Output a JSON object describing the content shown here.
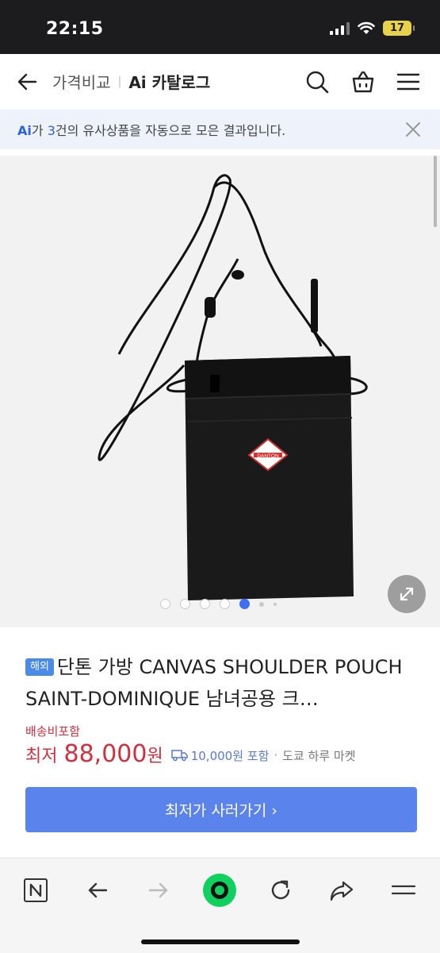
{
  "status_bar": {
    "time": "22:15",
    "battery": "17"
  },
  "header": {
    "breadcrumb_1": "가격비교",
    "breadcrumb_2": "Ai 카탈로그",
    "icons": [
      "back-arrow-icon",
      "search-icon",
      "cart-icon",
      "menu-icon"
    ]
  },
  "banner": {
    "ai": "Ai",
    "text_before": "가 ",
    "count": "3",
    "text_after": "건의 유사상품을 자동으로 모은 결과입니다."
  },
  "gallery": {
    "total_dots": 7,
    "active_index": 4,
    "badge_text": "DANTON"
  },
  "product": {
    "overseas_badge": "해외",
    "title": "단톤 가방 CANVAS SHOULDER POUCH SAINT-DOMINIQUE 남녀공용 크…",
    "shipping_label": "배송비포함",
    "price_prefix": "최저",
    "price_value": "88,000",
    "price_unit": "원",
    "shipping_fee": "10,000원 포함",
    "separator": "·",
    "seller": "도쿄 하루 마켓",
    "buy_button": "최저가 사러가기 ›"
  },
  "toolbar": {
    "items": [
      "naver-n-icon",
      "back-icon",
      "forward-icon",
      "green-home-icon",
      "reload-icon",
      "share-icon",
      "menu-lines-icon"
    ]
  },
  "colors": {
    "accent": "#5b83ec",
    "price": "#d0303f",
    "banner_bg": "#eef3fb",
    "green": "#10d060"
  }
}
